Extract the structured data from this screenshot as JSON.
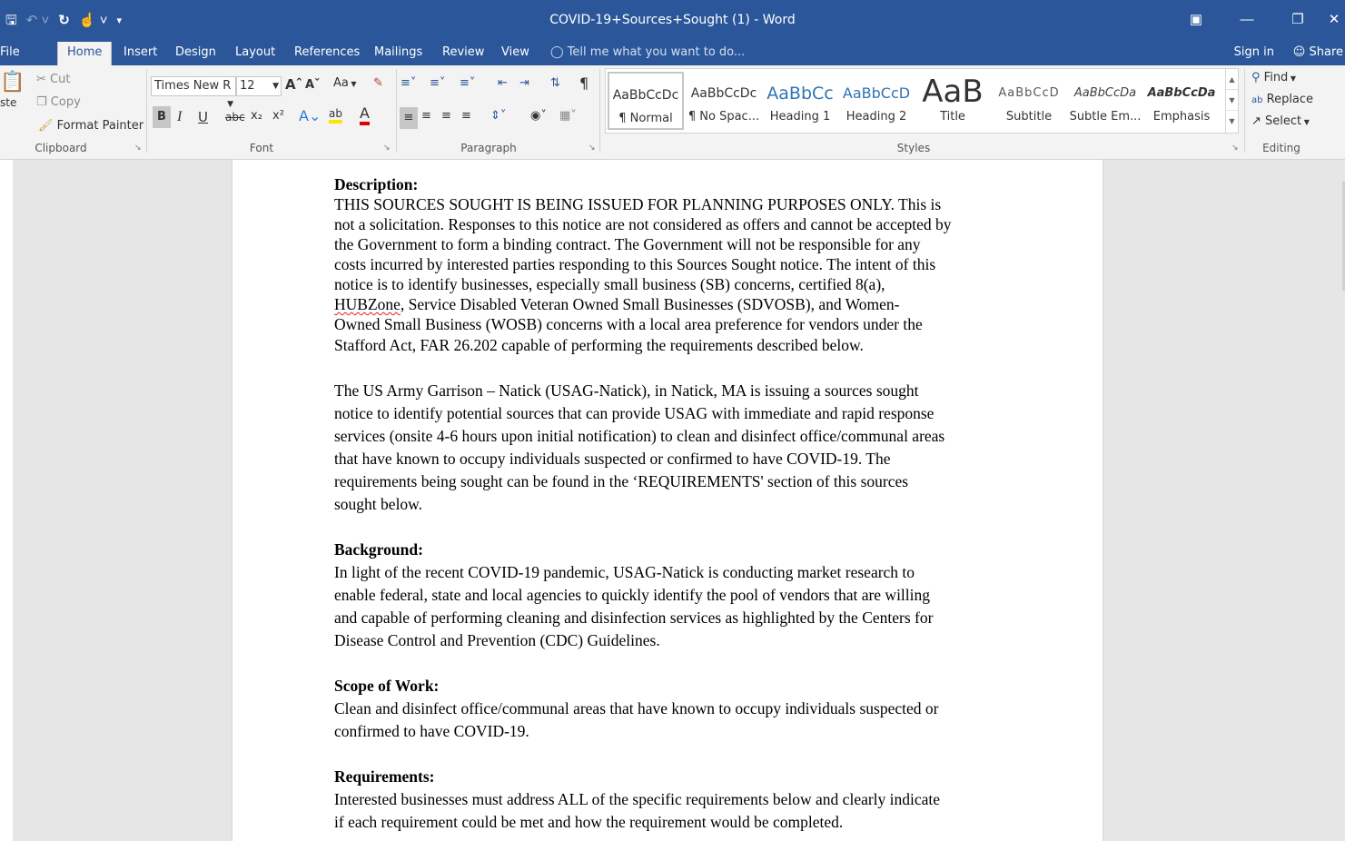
{
  "window": {
    "title": "COVID-19+Sources+Sought (1) - Word",
    "controls": [
      "ribbon-display",
      "minimize",
      "restore",
      "close"
    ]
  },
  "tabs": {
    "file": "File",
    "home": "Home",
    "insert": "Insert",
    "design": "Design",
    "layout": "Layout",
    "references": "References",
    "mailings": "Mailings",
    "review": "Review",
    "view": "View",
    "active": "Home"
  },
  "tell_me": {
    "placeholder": "Tell me what you want to do..."
  },
  "account": {
    "sign_in": "Sign in",
    "share": "Share"
  },
  "clipboard": {
    "paste": "ste",
    "cut": "Cut",
    "copy": "Copy",
    "format_painter": "Format Painter",
    "label": "Clipboard"
  },
  "font": {
    "name": "Times New R",
    "size": "12",
    "label": "Font",
    "change_case": "Aa",
    "bold": "B",
    "italic": "I",
    "underline": "U",
    "strikethrough": "abc",
    "subscript": "x₂",
    "superscript": "x²",
    "highlight": "ab",
    "font_color": "A"
  },
  "paragraph": {
    "label": "Paragraph",
    "pilcrow": "¶"
  },
  "styles": {
    "label": "Styles",
    "items": [
      {
        "sample": "AaBbCcDc",
        "name": "¶ Normal"
      },
      {
        "sample": "AaBbCcDc",
        "name": "¶ No Spac..."
      },
      {
        "sample": "AaBbCc",
        "name": "Heading 1"
      },
      {
        "sample": "AaBbCcD",
        "name": "Heading 2"
      },
      {
        "sample": "AaB",
        "name": "Title"
      },
      {
        "sample": "AaBbCcD",
        "name": "Subtitle"
      },
      {
        "sample": "AaBbCcDa",
        "name": "Subtle Em..."
      },
      {
        "sample": "AaBbCcDa",
        "name": "Emphasis"
      }
    ],
    "selected": "Normal"
  },
  "editing": {
    "find": "Find",
    "replace": "Replace",
    "select": "Select",
    "label": "Editing"
  },
  "document": {
    "description_heading": "Description:",
    "description_lines": [
      "THIS SOURCES SOUGHT IS BEING ISSUED FOR PLANNING PURPOSES ONLY. This is",
      "not a solicitation. Responses to this notice are not considered as offers and cannot be accepted by",
      "the Government to form a binding contract. The Government will not be responsible for any",
      "costs incurred by interested parties responding to this Sources Sought notice. The intent of this",
      "notice is to identify businesses, especially small business (SB) concerns, certified 8(a),",
      ", Service Disabled Veteran Owned Small Businesses (SDVOSB), and Women-",
      "Owned Small Business (WOSB) concerns with a local area preference for vendors under the",
      "Stafford Act, FAR 26.202 capable of performing the requirements described below."
    ],
    "hubzone_word": "HUBZone",
    "usag_lines": [
      "The US Army Garrison – Natick (USAG-Natick), in Natick, MA is issuing a sources sought",
      "notice to identify potential sources that can provide USAG with immediate and rapid response",
      "services (onsite 4-6 hours upon initial notification) to clean and disinfect office/communal areas",
      "that have known to occupy individuals suspected or confirmed to have COVID-19. The",
      "requirements being sought can be found in the ‘REQUIREMENTS' section of this sources",
      "sought below."
    ],
    "background_heading": "Background:",
    "background_lines": [
      "In light of the recent COVID-19 pandemic, USAG-Natick is conducting market research to",
      "enable federal, state and local agencies to quickly identify the pool of vendors that are willing",
      "and capable of performing cleaning and disinfection services as highlighted by the Centers for",
      "Disease Control and Prevention (CDC) Guidelines."
    ],
    "scope_heading": "Scope of Work:",
    "scope_lines": [
      "Clean and disinfect office/communal areas that have known to occupy individuals suspected or",
      "confirmed to have COVID-19."
    ],
    "requirements_heading": "Requirements:",
    "requirements_lines": [
      "Interested businesses must address ALL of the specific requirements below and clearly indicate",
      "if each requirement could be met and how the requirement would be completed."
    ]
  },
  "colors": {
    "ribbon_blue": "#2b579a",
    "ribbon_bg": "#f3f3f3",
    "canvas": "#e6e6e6",
    "heading1_blue": "#2e74b5"
  }
}
